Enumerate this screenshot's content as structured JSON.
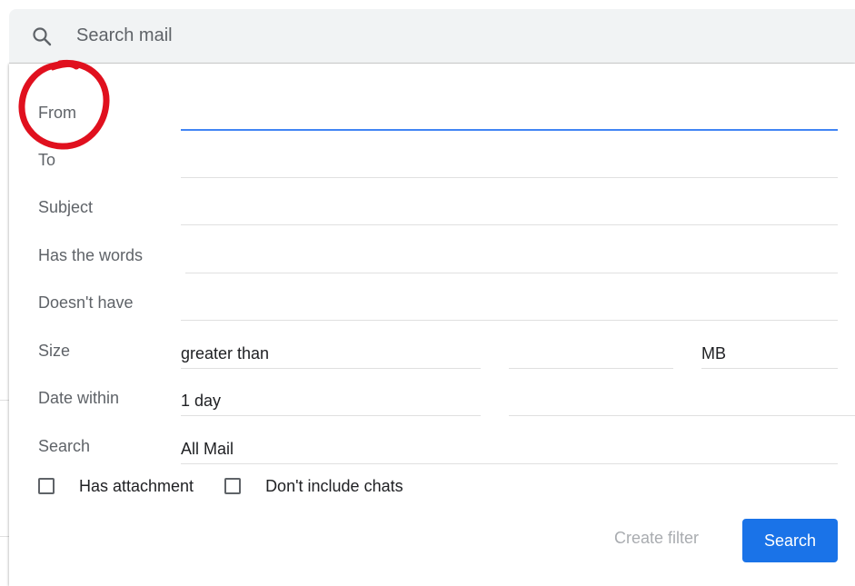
{
  "search_bar": {
    "placeholder": "Search mail",
    "icon": "search-icon"
  },
  "form": {
    "from_label": "From",
    "to_label": "To",
    "subject_label": "Subject",
    "has_words_label": "Has the words",
    "doesnt_have_label": "Doesn't have",
    "size_label": "Size",
    "size_operator": "greater than",
    "size_unit": "MB",
    "date_within_label": "Date within",
    "date_within_value": "1 day",
    "search_label": "Search",
    "search_scope": "All Mail",
    "has_attachment_label": "Has attachment",
    "dont_include_chats_label": "Don't include chats"
  },
  "actions": {
    "create_filter_label": "Create filter",
    "search_label": "Search"
  },
  "colors": {
    "accent": "#1a73e8",
    "active_underline": "#4285f4",
    "annotation": "#e0101e"
  }
}
